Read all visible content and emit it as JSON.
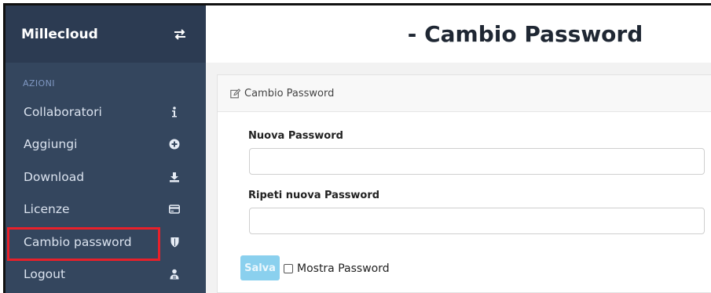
{
  "sidebar": {
    "brand": "Millecloud",
    "section_label": "AZIONI",
    "items": [
      {
        "label": "Collaboratori",
        "icon": "info-icon"
      },
      {
        "label": "Aggiungi",
        "icon": "plus-circle-icon"
      },
      {
        "label": "Download",
        "icon": "download-icon"
      },
      {
        "label": "Licenze",
        "icon": "credit-card-icon"
      },
      {
        "label": "Cambio password",
        "icon": "shield-icon",
        "highlighted": true
      },
      {
        "label": "Logout",
        "icon": "users-icon"
      }
    ]
  },
  "header": {
    "title": "- Cambio Password"
  },
  "panel": {
    "heading": "Cambio Password"
  },
  "form": {
    "new_password_label": "Nuova Password",
    "new_password_value": "",
    "repeat_password_label": "Ripeti nuova Password",
    "repeat_password_value": "",
    "save_label": "Salva",
    "show_password_label": "Mostra Password",
    "show_password_checked": false
  },
  "colors": {
    "sidebar_bg": "#34465e",
    "brand_bg": "#2c3b52",
    "highlight_border": "#e8202a",
    "save_button": "#8ad0ee"
  }
}
